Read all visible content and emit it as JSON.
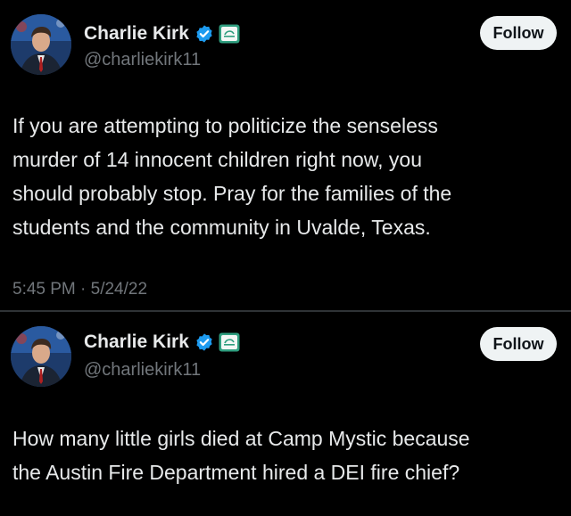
{
  "colors": {
    "background": "#000000",
    "text_primary": "#e7e9ea",
    "text_secondary": "#71767b",
    "verified_badge": "#1d9bf0",
    "affiliate_badge": "#2f9e7f",
    "follow_button_bg": "#eff3f4"
  },
  "tweets": [
    {
      "author": {
        "display_name": "Charlie Kirk",
        "handle": "@charliekirk11",
        "verified_icon": "verified-badge-icon",
        "affiliate_icon": "affiliate-org-badge-icon"
      },
      "follow_label": "Follow",
      "text_lines": [
        "If you are attempting to politicize the senseless",
        "murder of 14 innocent children right now, you",
        "should probably stop. Pray for the families of the",
        "students and the community in Uvalde, Texas."
      ],
      "timestamp": "5:45 PM · 5/24/22"
    },
    {
      "author": {
        "display_name": "Charlie Kirk",
        "handle": "@charliekirk11",
        "verified_icon": "verified-badge-icon",
        "affiliate_icon": "affiliate-org-badge-icon"
      },
      "follow_label": "Follow",
      "text_lines": [
        "How many little girls died at Camp Mystic because",
        "the Austin Fire Department hired a DEI fire chief?"
      ]
    }
  ]
}
